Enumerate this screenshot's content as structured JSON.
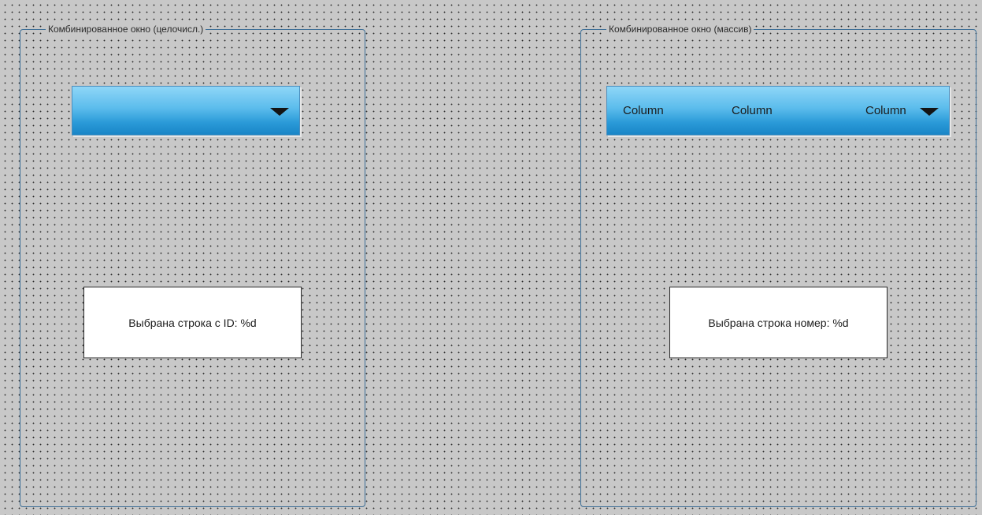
{
  "left_group": {
    "title": "Комбинированное окно (целочисл.)",
    "combo": {
      "value": "",
      "arrow_icon": "chevron-down-icon"
    },
    "text": "Выбрана строка с ID: %d"
  },
  "right_group": {
    "title": "Комбинированное окно (массив)",
    "combo": {
      "columns": [
        "Column",
        "Column",
        "Column"
      ],
      "arrow_icon": "chevron-down-icon"
    },
    "text": "Выбрана строка номер: %d"
  },
  "colors": {
    "canvas_background": "#c8c8c8",
    "grid_dot": "#2a2a2a",
    "group_border": "#3c6e96",
    "combo_gradient_top": "#8fd6f7",
    "combo_gradient_bottom": "#1985c6",
    "textbox_background": "#ffffff"
  }
}
